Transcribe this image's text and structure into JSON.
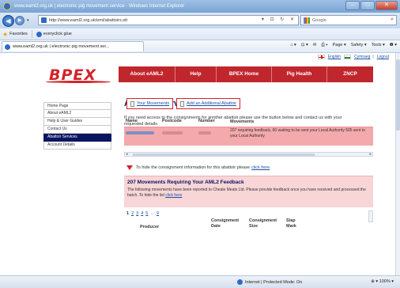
{
  "window": {
    "title": "www.eaml2.org.uk | electronic pig movement service - Windows Internet Explorer",
    "controls": [
      "–",
      "□",
      "✕"
    ]
  },
  "navbar": {
    "address": "http://www.eaml2.org.uk/eml/abattoirs.stt",
    "address_tools": "▾ ⊡ ↻ ✕",
    "search_engine": "Google",
    "search_icon": "⌕"
  },
  "favorites": {
    "label": "Favorites",
    "item": "everyclick glue"
  },
  "tab": {
    "label": "www.eaml2.org.uk | electronic pig movement ser..."
  },
  "commands": [
    "⌂ ▾",
    "⊡ ▾",
    "✉",
    "⎙ ▾",
    "Page ▾",
    "Safety ▾",
    "Tools ▾",
    "❷ ▾"
  ],
  "site": {
    "logo": "BPEX",
    "lang_links": [
      "English",
      "Cymraeg"
    ],
    "logout": "Logout",
    "nav": [
      {
        "label": "About eAML2"
      },
      {
        "label": "Help"
      },
      {
        "label": "BPEX Home"
      },
      {
        "label": "Pig Health"
      },
      {
        "label": "ZNCP"
      }
    ],
    "side": [
      {
        "label": "Home Page",
        "active": false
      },
      {
        "label": "About eAML2",
        "active": false
      },
      {
        "label": "Help & User Guides",
        "active": false
      },
      {
        "label": "Contact Us",
        "active": false
      },
      {
        "label": "Abattoir Services",
        "active": true
      },
      {
        "label": "Account Details",
        "active": false
      }
    ]
  },
  "main": {
    "title": "Abattoir Services",
    "intro": "If you need access to the consignments for another abattoir please use the button below and contact us with your requested details.",
    "btn_movements": "Your Movements",
    "btn_add": "Add an Additional Abattoir",
    "table_headers": [
      "Name",
      "Postcode",
      "Number",
      "Movements"
    ],
    "row_movements": "207 requiring feedback, 60 waiting to be sent your Local Authority 505 sent to your Local Authority",
    "hide_text": "To hide the consignment information for this abattoir please",
    "hide_link": "click here",
    "feedback_title": "207 Movements Requiring Your AML2 Feedback",
    "feedback_text": "The following movements have been reported to Cheale Meats Ltd. Please provide feedback once you have received and processed the batch. To hide the list",
    "feedback_link": "click here",
    "pager": [
      "1",
      "2",
      "3",
      "4",
      "5",
      "...",
      "9"
    ],
    "col_producer": "Producer",
    "col_cons_date": "Consignment Date",
    "col_cons_size": "Consignment Size",
    "col_slap": "Slap Mark"
  },
  "status": {
    "zone": "Internet | Protected Mode: On",
    "zoom": "⊕ ▾  100% ▾"
  },
  "colors": {
    "brand_red": "#c0272d",
    "nav_dark": "#0a1560",
    "row_pink": "#f4a9ac"
  }
}
